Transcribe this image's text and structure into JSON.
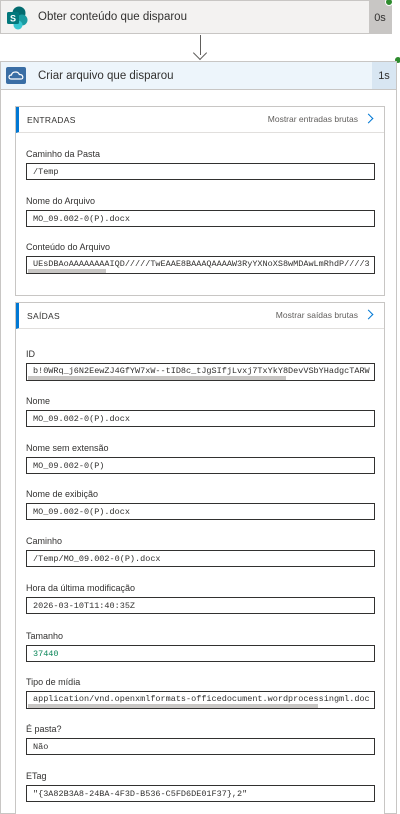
{
  "step1": {
    "title": "Obter conteúdo que disparou",
    "duration": "0s"
  },
  "step2": {
    "title": "Criar arquivo que disparou",
    "duration": "1s"
  },
  "inputs": {
    "header": "ENTRADAS",
    "raw_link": "Mostrar entradas brutas",
    "fields": [
      {
        "label": "Caminho da Pasta",
        "value": "/Temp"
      },
      {
        "label": "Nome do Arquivo",
        "value": "MO_09.002-0(P).docx"
      },
      {
        "label": "Conteúdo do Arquivo",
        "value": "UEsDBAoAAAAAAAAIQD/////TwEAAE8BAAAQAAAAW3RyYXNoXS8wMDAwLmRhdP////3"
      }
    ]
  },
  "outputs": {
    "header": "SAÍDAS",
    "raw_link": "Mostrar saídas brutas",
    "fields": [
      {
        "label": "ID",
        "value": "b!0WRq_j6N2EewZJ4GfYW7xW--tID8c_tJgSIfjLvxj7TxYkY8DevVSbYHadgcTARW"
      },
      {
        "label": "Nome",
        "value": "MO_09.002-0(P).docx"
      },
      {
        "label": "Nome sem extensão",
        "value": "MO_09.002-0(P)"
      },
      {
        "label": "Nome de exibição",
        "value": "MO_09.002-0(P).docx"
      },
      {
        "label": "Caminho",
        "value": "/Temp/MO_09.002-0(P).docx"
      },
      {
        "label": "Hora da última modificação",
        "value": "2026-03-10T11:40:35Z"
      },
      {
        "label": "Tamanho",
        "value": "37440"
      },
      {
        "label": "Tipo de mídia",
        "value": "application/vnd.openxmlformats-officedocument.wordprocessingml.doc"
      },
      {
        "label": "É pasta?",
        "value": "Não"
      },
      {
        "label": "ETag",
        "value": "\"{3A82B3A8-24BA-4F3D-B536-C5FD6DE01F37},2\""
      }
    ]
  },
  "colors": {
    "accent": "#0078d4",
    "success": "#2e8b2e",
    "sharepoint": "#036c70"
  }
}
